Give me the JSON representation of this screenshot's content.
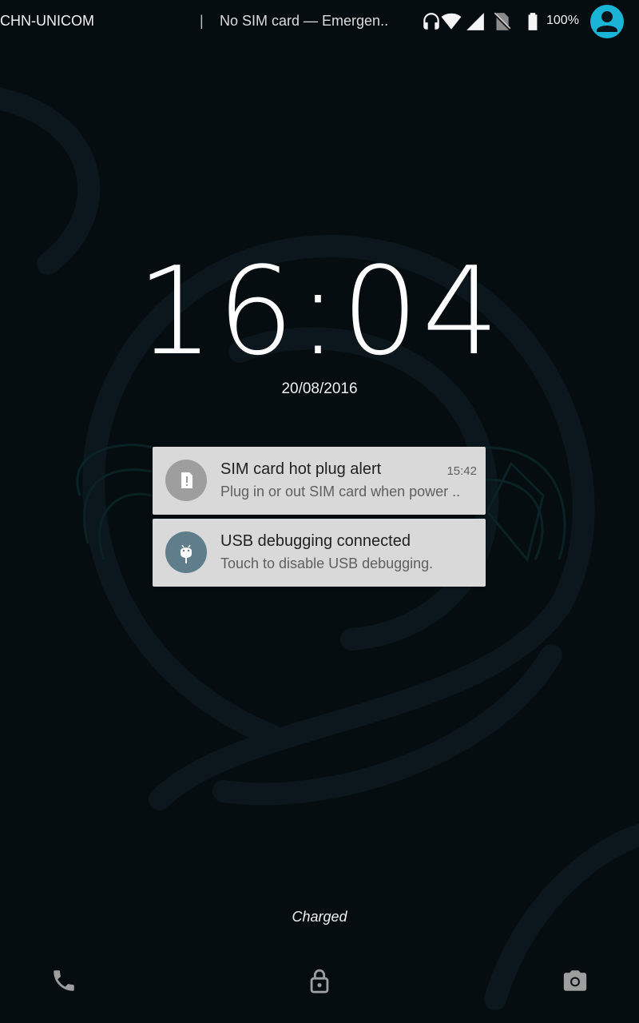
{
  "status_bar": {
    "carrier": "CHN-UNICOM",
    "separator": "|",
    "sim_status": "No SIM card — Emergen..",
    "battery_percent": "100%",
    "icons": [
      "headset-icon",
      "wifi-icon",
      "cell-signal-icon",
      "no-sim-icon",
      "battery-icon",
      "user-avatar-icon"
    ],
    "avatar_color": "#1ab5d6"
  },
  "lockscreen": {
    "time": "16:04",
    "date": "20/08/2016",
    "charging_status": "Charged"
  },
  "notifications": [
    {
      "title": "SIM card hot plug alert",
      "text": "Plug in or out SIM card when power ..",
      "time": "15:42",
      "icon": "sim-alert-icon",
      "icon_bg": "#9e9e9e"
    },
    {
      "title": "USB debugging connected",
      "text": "Touch to disable USB debugging.",
      "time": "",
      "icon": "android-debug-icon",
      "icon_bg": "#607d8b"
    }
  ],
  "bottom_actions": {
    "icons": [
      "phone-icon",
      "lock-icon",
      "camera-icon"
    ]
  }
}
